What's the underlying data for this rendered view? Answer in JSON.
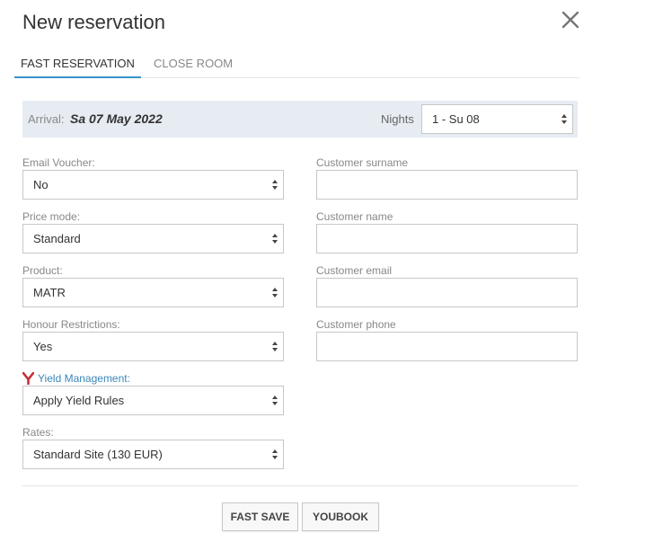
{
  "dialog": {
    "title": "New reservation"
  },
  "tabs": [
    {
      "label": "FAST RESERVATION",
      "active": true
    },
    {
      "label": "CLOSE ROOM",
      "active": false
    }
  ],
  "arrival": {
    "label": "Arrival:",
    "date": "Sa 07 May 2022",
    "nights_label": "Nights",
    "nights_value": "1 - Su 08"
  },
  "left_fields": {
    "email_voucher": {
      "label": "Email Voucher:",
      "value": "No"
    },
    "price_mode": {
      "label": "Price mode:",
      "value": "Standard"
    },
    "product": {
      "label": "Product:",
      "value": "MATR"
    },
    "honour_restrictions": {
      "label": "Honour Restrictions:",
      "value": "Yes"
    },
    "yield_management": {
      "label": "Yield Management:",
      "value": "Apply Yield Rules"
    },
    "rates": {
      "label": "Rates:",
      "value": "Standard Site (130 EUR)"
    }
  },
  "right_fields": {
    "customer_surname": {
      "label": "Customer surname",
      "value": ""
    },
    "customer_name": {
      "label": "Customer name",
      "value": ""
    },
    "customer_email": {
      "label": "Customer email",
      "value": ""
    },
    "customer_phone": {
      "label": "Customer phone",
      "value": ""
    }
  },
  "buttons": {
    "fast_save": "FAST SAVE",
    "youbook": "YOUBOOK"
  },
  "colors": {
    "accent_blue": "#3a93c6",
    "bar_bg": "#e6ecf2",
    "yield_icon": "#c8303a"
  },
  "icons": {
    "close": "close-x-icon",
    "yield": "yield-y-icon",
    "select_arrows": "updown-arrows-icon"
  }
}
